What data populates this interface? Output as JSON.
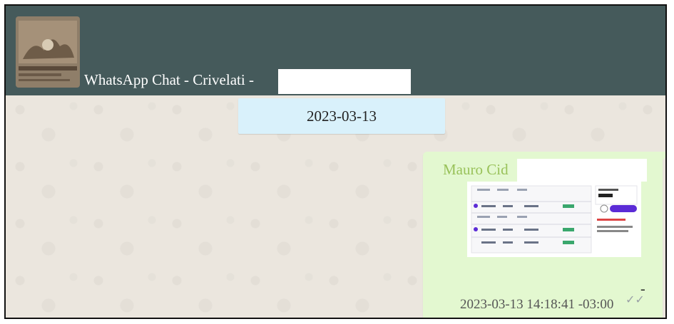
{
  "header": {
    "title": "WhatsApp Chat - Crivelati -",
    "avatar_icon": "profile-photo-icon"
  },
  "chat": {
    "date_separator": "2023-03-13",
    "messages": [
      {
        "sender": "Mauro Cid",
        "attachment_icon": "image-attachment-icon",
        "caption": "-",
        "timestamp": "2023-03-13 14:18:41 -03:00",
        "status_icon": "double-check-icon",
        "status_glyph": "✓✓"
      }
    ]
  },
  "colors": {
    "header_bg": "#455a5b",
    "chat_bg": "#ebe6de",
    "date_chip_bg": "#d9f1fb",
    "outgoing_bubble_bg": "#e3f8d0",
    "sender_name": "#99c25a",
    "accent_purple": "#5b2bd6"
  }
}
